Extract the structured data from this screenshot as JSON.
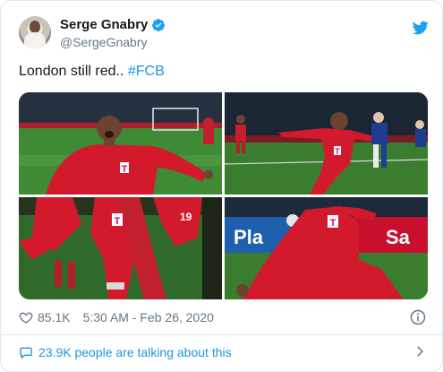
{
  "author": {
    "display_name": "Serge Gnabry",
    "handle": "@SergeGnabry",
    "verified_icon": "verified-badge-icon",
    "avatar_icon": "profile-avatar"
  },
  "tweet": {
    "text": "London still red.. ",
    "hashtag": "#FCB"
  },
  "media": {
    "photos": [
      {
        "name": "photo-celebration-shout",
        "sponsor": "T"
      },
      {
        "name": "photo-celebration-run",
        "sponsor": "T"
      },
      {
        "name": "photo-celebration-closeup",
        "sponsor": "T",
        "number": "19"
      },
      {
        "name": "photo-knee-slide",
        "sponsor": "T",
        "ad_text": "Pla",
        "ad_text_2": "Sa"
      }
    ]
  },
  "stats": {
    "likes": "85.1K",
    "timestamp": "5:30 AM - Feb 26, 2020"
  },
  "footer": {
    "conversation_text": "23.9K people are talking about this"
  },
  "colors": {
    "accent": "#1b95e0",
    "text": "#14171a",
    "muted": "#657786",
    "kit_red": "#d7192b",
    "pitch_green": "#3b7d2e"
  }
}
